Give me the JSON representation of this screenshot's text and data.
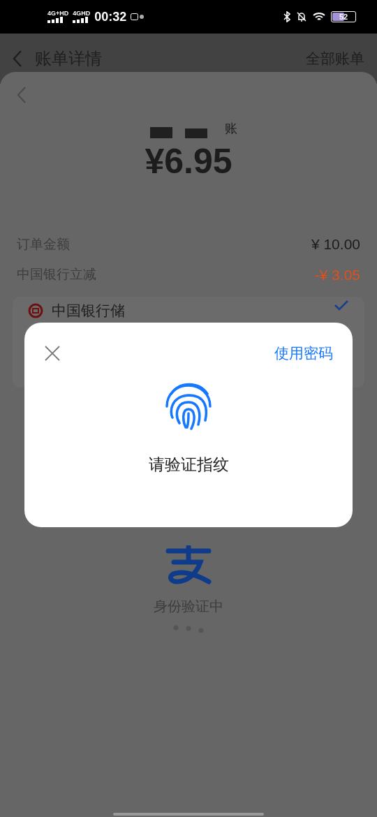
{
  "status_bar": {
    "network_1": "4G+HD",
    "network_2": "4GHD",
    "time": "00:32",
    "battery": "52"
  },
  "header": {
    "title": "账单详情",
    "action": "全部账单"
  },
  "bill": {
    "payee_suffix": "账",
    "amount": "¥6.95",
    "lines": [
      {
        "label": "订单金额",
        "value": "¥  10.00",
        "kind": "normal"
      },
      {
        "label": "中国银行立减",
        "value": "-¥  3.05",
        "kind": "discount"
      }
    ],
    "payment_method": {
      "name": "中国银行储",
      "selected": true
    }
  },
  "dialog": {
    "action": "使用密码",
    "prompt": "请验证指纹"
  },
  "verifying": {
    "text": "身份验证中"
  }
}
